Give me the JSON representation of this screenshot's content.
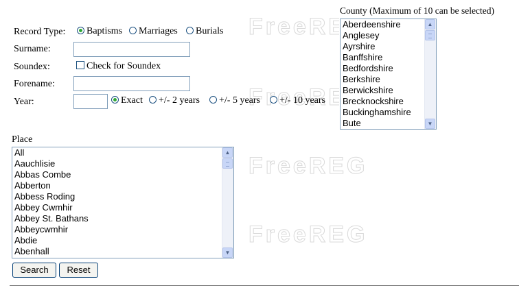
{
  "watermark": "FreeREG",
  "record_type": {
    "label": "Record Type:",
    "options": [
      "Baptisms",
      "Marriages",
      "Burials"
    ],
    "selected": "Baptisms"
  },
  "surname": {
    "label": "Surname:",
    "value": ""
  },
  "soundex": {
    "label": "Soundex:",
    "checkbox_label": "Check for Soundex",
    "checked": false
  },
  "forename": {
    "label": "Forename:",
    "value": ""
  },
  "year": {
    "label": "Year:",
    "value": "",
    "options": [
      "Exact",
      "+/- 2 years",
      "+/- 5 years",
      "+/- 10 years"
    ],
    "selected": "Exact"
  },
  "county": {
    "label": "County (Maximum of 10 can be selected)",
    "items": [
      "Aberdeenshire",
      "Anglesey",
      "Ayrshire",
      "Banffshire",
      "Bedfordshire",
      "Berkshire",
      "Berwickshire",
      "Brecknockshire",
      "Buckinghamshire",
      "Bute"
    ]
  },
  "place": {
    "label": "Place",
    "items": [
      "All",
      "Aauchlisie",
      "Abbas Combe",
      "Abberton",
      "Abbess Roding",
      "Abbey Cwmhir",
      "Abbey St. Bathans",
      "Abbeycwmhir",
      "Abdie",
      "Abenhall"
    ]
  },
  "buttons": {
    "search": "Search",
    "reset": "Reset"
  }
}
